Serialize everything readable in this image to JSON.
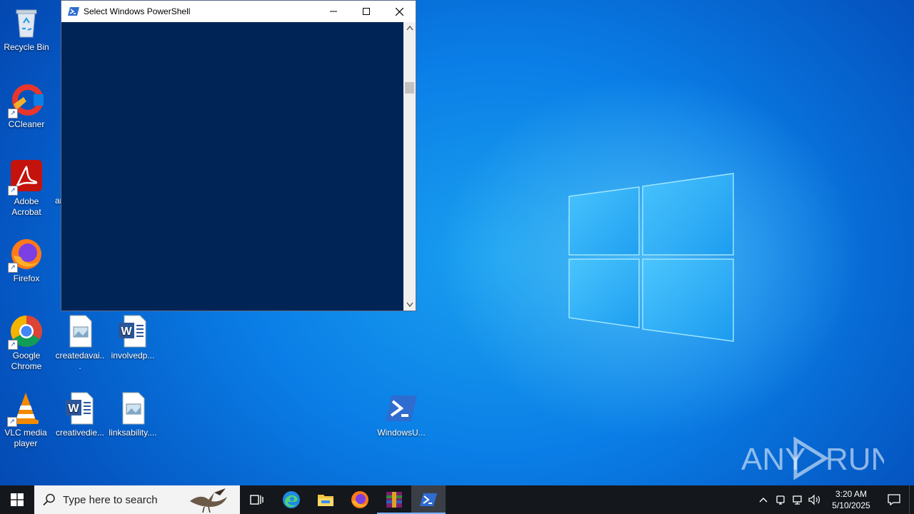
{
  "desktop": {
    "icons": [
      {
        "label": "Recycle Bin",
        "icon": "recycle-bin-icon"
      },
      {
        "label": "CCleaner",
        "icon": "ccleaner-icon"
      },
      {
        "label": "Adobe Acrobat",
        "icon": "adobe-acrobat-icon"
      },
      {
        "label": "Firefox",
        "icon": "firefox-icon"
      },
      {
        "label": "Google Chrome",
        "icon": "chrome-icon"
      },
      {
        "label": "VLC media player",
        "icon": "vlc-icon"
      },
      {
        "label": "createdavai...",
        "icon": "image-file-icon"
      },
      {
        "label": "involvedp...",
        "icon": "word-doc-icon"
      },
      {
        "label": "creativedie...",
        "icon": "word-doc-icon"
      },
      {
        "label": "linksability....",
        "icon": "image-file-icon"
      },
      {
        "label": "WindowsU...",
        "icon": "powershell-script-icon"
      }
    ],
    "partial_label": "ar"
  },
  "powershell_window": {
    "title": "Select Windows PowerShell",
    "minimize": "—",
    "maximize": "☐",
    "close": "✕",
    "console_bg": "#012456"
  },
  "taskbar": {
    "search_placeholder": "Type here to search",
    "pinned": [
      "task-view-icon",
      "edge-icon",
      "file-explorer-icon",
      "firefox-icon",
      "winrar-icon",
      "powershell-icon"
    ],
    "clock_time": "3:20 AM",
    "clock_date": "5/10/2025"
  },
  "watermark": {
    "text": "ANY RUN"
  }
}
